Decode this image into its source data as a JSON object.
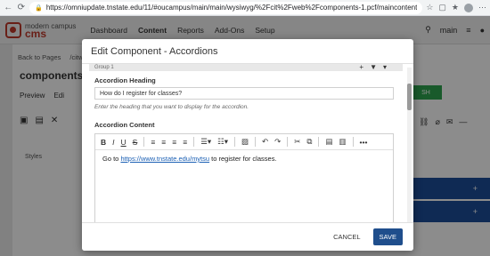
{
  "browser": {
    "url": "https://omniupdate.tnstate.edu/11/#oucampus/main/main/wysiwyg/%2Fcit%2Fweb%2Fcomponents-1.pcf/maincontent"
  },
  "app": {
    "logo_top": "modern campus",
    "logo_main": "cms",
    "menu": [
      "Dashboard",
      "Content",
      "Reports",
      "Add-Ons",
      "Setup"
    ],
    "site_selector": "main"
  },
  "background": {
    "back_link": "Back to Pages",
    "breadcrumb_partial": "/citw",
    "page_title": "components",
    "tab_preview": "Preview",
    "tab_edit": "Edi",
    "styles_label": "Styles",
    "publish_partial": "SH"
  },
  "modal": {
    "title": "Edit Component - Accordions",
    "group_label": "Group 1",
    "heading_label": "Accordion Heading",
    "heading_value": "How do I register for classes?",
    "heading_help": "Enter the heading that you want to display for the accordion.",
    "content_label": "Accordion Content",
    "content_before": "Go to ",
    "content_link": "https://www.tnstate.edu/mytsu",
    "content_after": " to register for classes.",
    "cancel": "CANCEL",
    "save": "SAVE"
  },
  "colors": {
    "brand_red": "#c0392b",
    "save_blue": "#1f4e8c",
    "accordion_blue": "#1d4e9a",
    "publish_green": "#2ea44f"
  }
}
